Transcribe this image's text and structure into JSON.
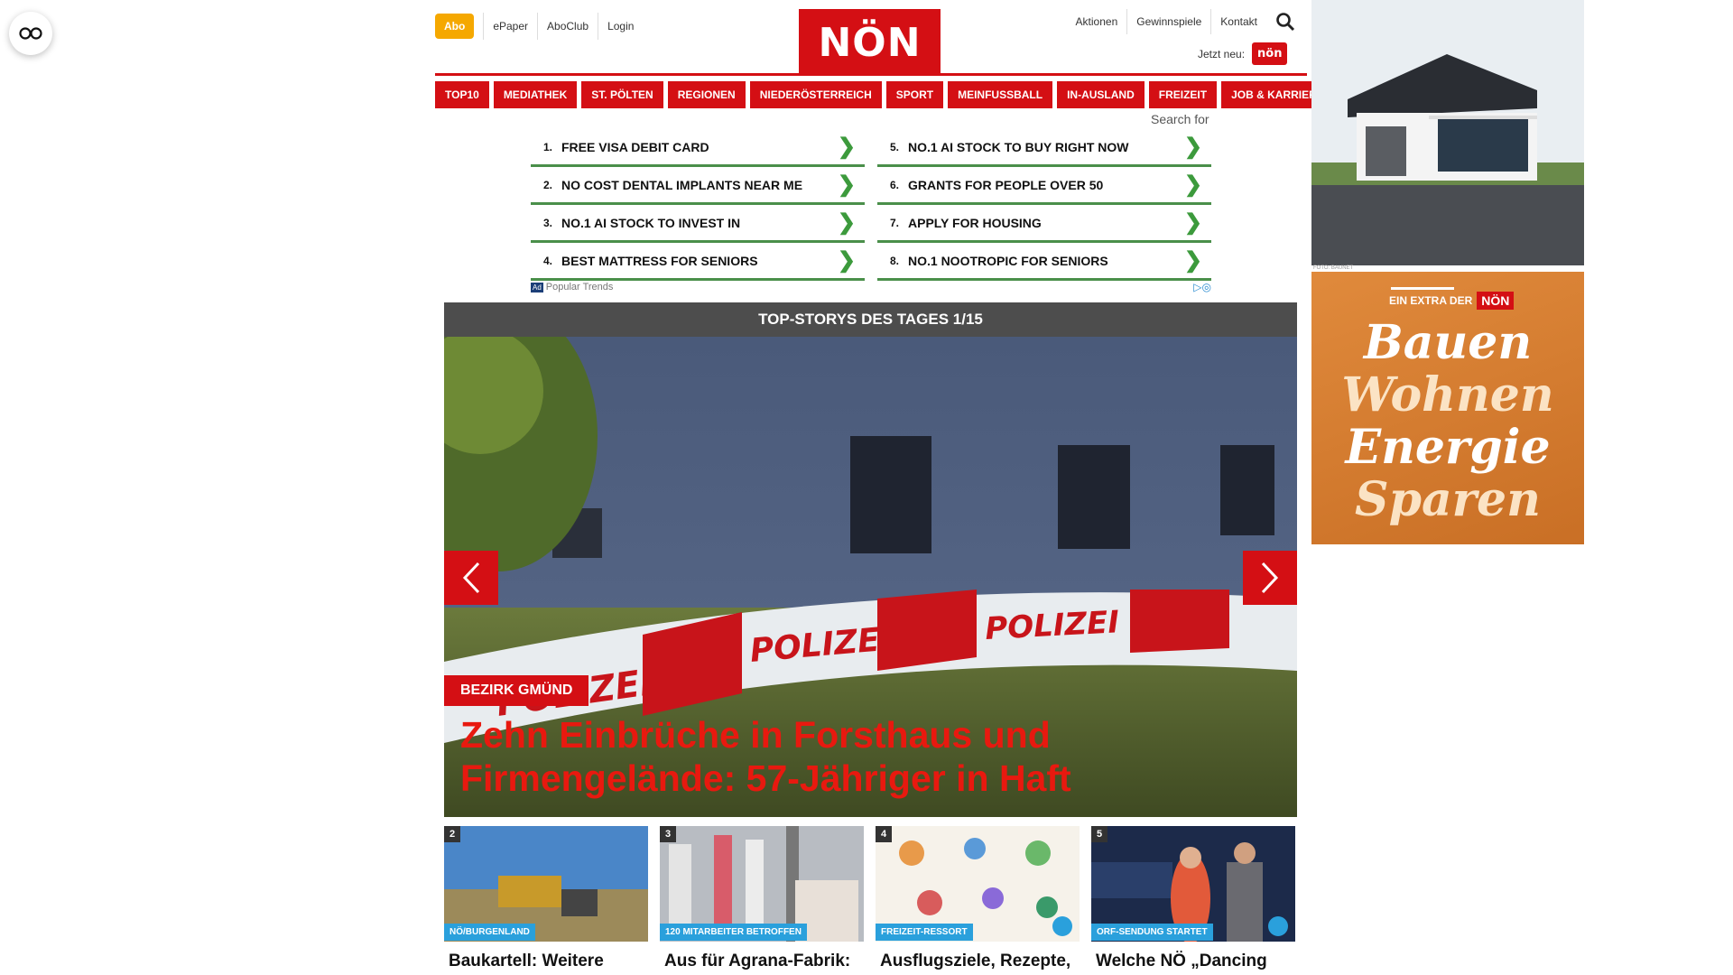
{
  "header": {
    "abo_label": "Abo",
    "top_links": [
      "ePaper",
      "AboClub",
      "Login"
    ],
    "logo_text": "NÖN",
    "right_links": [
      "Aktionen",
      "Gewinnspiele",
      "Kontakt"
    ],
    "jetzt_label": "Jetzt neu:",
    "jetzt_badge": "nön"
  },
  "categories": [
    "TOP10",
    "MEDIATHEK",
    "ST. PÖLTEN",
    "REGIONEN",
    "NIEDERÖSTERREICH",
    "SPORT",
    "MEINFUSSBALL",
    "IN-AUSLAND",
    "FREIZEIT",
    "JOB & KARRIERE"
  ],
  "ad_search": {
    "search_label": "Search for",
    "items": [
      {
        "n": "1.",
        "text": "FREE VISA DEBIT CARD"
      },
      {
        "n": "5.",
        "text": "NO.1 AI STOCK TO BUY RIGHT NOW"
      },
      {
        "n": "2.",
        "text": "NO COST DENTAL IMPLANTS NEAR ME"
      },
      {
        "n": "6.",
        "text": "GRANTS FOR PEOPLE OVER 50"
      },
      {
        "n": "3.",
        "text": "NO.1 AI STOCK TO INVEST IN"
      },
      {
        "n": "7.",
        "text": "APPLY FOR HOUSING"
      },
      {
        "n": "4.",
        "text": "BEST MATTRESS FOR SENIORS"
      },
      {
        "n": "8.",
        "text": "NO.1 NOOTROPIC FOR SENIORS"
      }
    ],
    "ad_tag": "Ad",
    "footer_text": "Popular Trends"
  },
  "top_stories": {
    "bar_label": "TOP-STORYS DES TAGES 1/15",
    "hero_tag": "BEZIRK GMÜND",
    "hero_title": "Zehn Einbrüche in Forsthaus und Firmengelände: 57-Jähriger in Haft",
    "tape_text": "POLIZEI"
  },
  "thumbnails": [
    {
      "idx": "2",
      "label": "NÖ/BURGENLAND",
      "title": "Baukartell: Weitere Millionen-Geldbuße",
      "camera": false
    },
    {
      "idx": "3",
      "label": "120 MITARBEITER BETROFFEN",
      "title": "Aus für Agrana-Fabrik: Gewerkschaft plädiert",
      "camera": false
    },
    {
      "idx": "4",
      "label": "FREIZEIT-RESSORT",
      "title": "Ausflugsziele, Rezepte, Gesundheitstipps und",
      "camera": true
    },
    {
      "idx": "5",
      "label": "ORF-SENDUNG STARTET",
      "title": "Welche NÖ „Dancing Stars“ ab morgen übers",
      "camera": true
    }
  ],
  "right_ads": {
    "credit": "FOTO: BAUNET",
    "extra_text": "EIN EXTRA DER",
    "extra_brand": "NÖN",
    "words": [
      "Bauen",
      "Wohnen",
      "Energie",
      "Sparen"
    ]
  },
  "colors": {
    "brand_red": "#d40f14",
    "abo_orange": "#f5a800",
    "ad_green": "#4a8f4a",
    "label_blue": "#2aa0dc",
    "bar_gray": "#4d4d4d"
  }
}
